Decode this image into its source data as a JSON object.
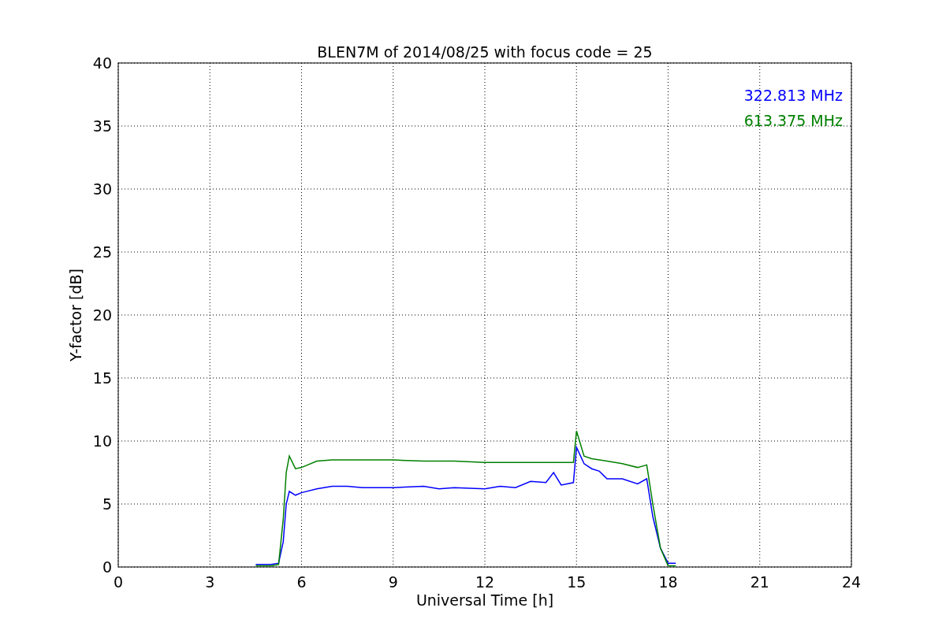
{
  "chart_data": {
    "type": "line",
    "title": "BLEN7M of 2014/08/25 with focus code = 25",
    "xlabel": "Universal Time [h]",
    "ylabel": "Y-factor [dB]",
    "xlim": [
      0,
      24
    ],
    "ylim": [
      0,
      40
    ],
    "xticks": [
      0,
      3,
      6,
      9,
      12,
      15,
      18,
      21,
      24
    ],
    "yticks": [
      0,
      5,
      10,
      15,
      20,
      25,
      30,
      35,
      40
    ],
    "grid": true,
    "x": [
      4.5,
      5,
      5.25,
      5.4,
      5.5,
      5.6,
      5.8,
      6,
      6.5,
      7,
      7.5,
      8,
      9,
      10,
      10.5,
      11,
      12,
      12.5,
      13,
      13.5,
      14,
      14.25,
      14.5,
      14.9,
      15,
      15.25,
      15.5,
      15.75,
      16,
      16.5,
      17,
      17.3,
      17.5,
      17.75,
      18,
      18.25
    ],
    "series": [
      {
        "name": "322.813 MHz",
        "color": "#0000ff",
        "values": [
          0.2,
          0.2,
          0.3,
          2,
          5,
          6,
          5.7,
          5.9,
          6.2,
          6.4,
          6.4,
          6.3,
          6.3,
          6.4,
          6.2,
          6.3,
          6.2,
          6.4,
          6.3,
          6.8,
          6.7,
          7.5,
          6.5,
          6.7,
          9.5,
          8.2,
          7.8,
          7.6,
          7.0,
          7.0,
          6.6,
          7.0,
          4,
          1.5,
          0.3,
          0.3
        ]
      },
      {
        "name": "613.375 MHz",
        "color": "#008000",
        "values": [
          0.1,
          0.1,
          0.2,
          3.8,
          7.5,
          8.8,
          7.8,
          7.9,
          8.4,
          8.5,
          8.5,
          8.5,
          8.5,
          8.4,
          8.4,
          8.4,
          8.3,
          8.3,
          8.3,
          8.3,
          8.3,
          8.3,
          8.3,
          8.3,
          10.8,
          8.8,
          8.6,
          8.5,
          8.4,
          8.2,
          7.9,
          8.1,
          5,
          1.5,
          0.1,
          0.1
        ]
      }
    ]
  }
}
